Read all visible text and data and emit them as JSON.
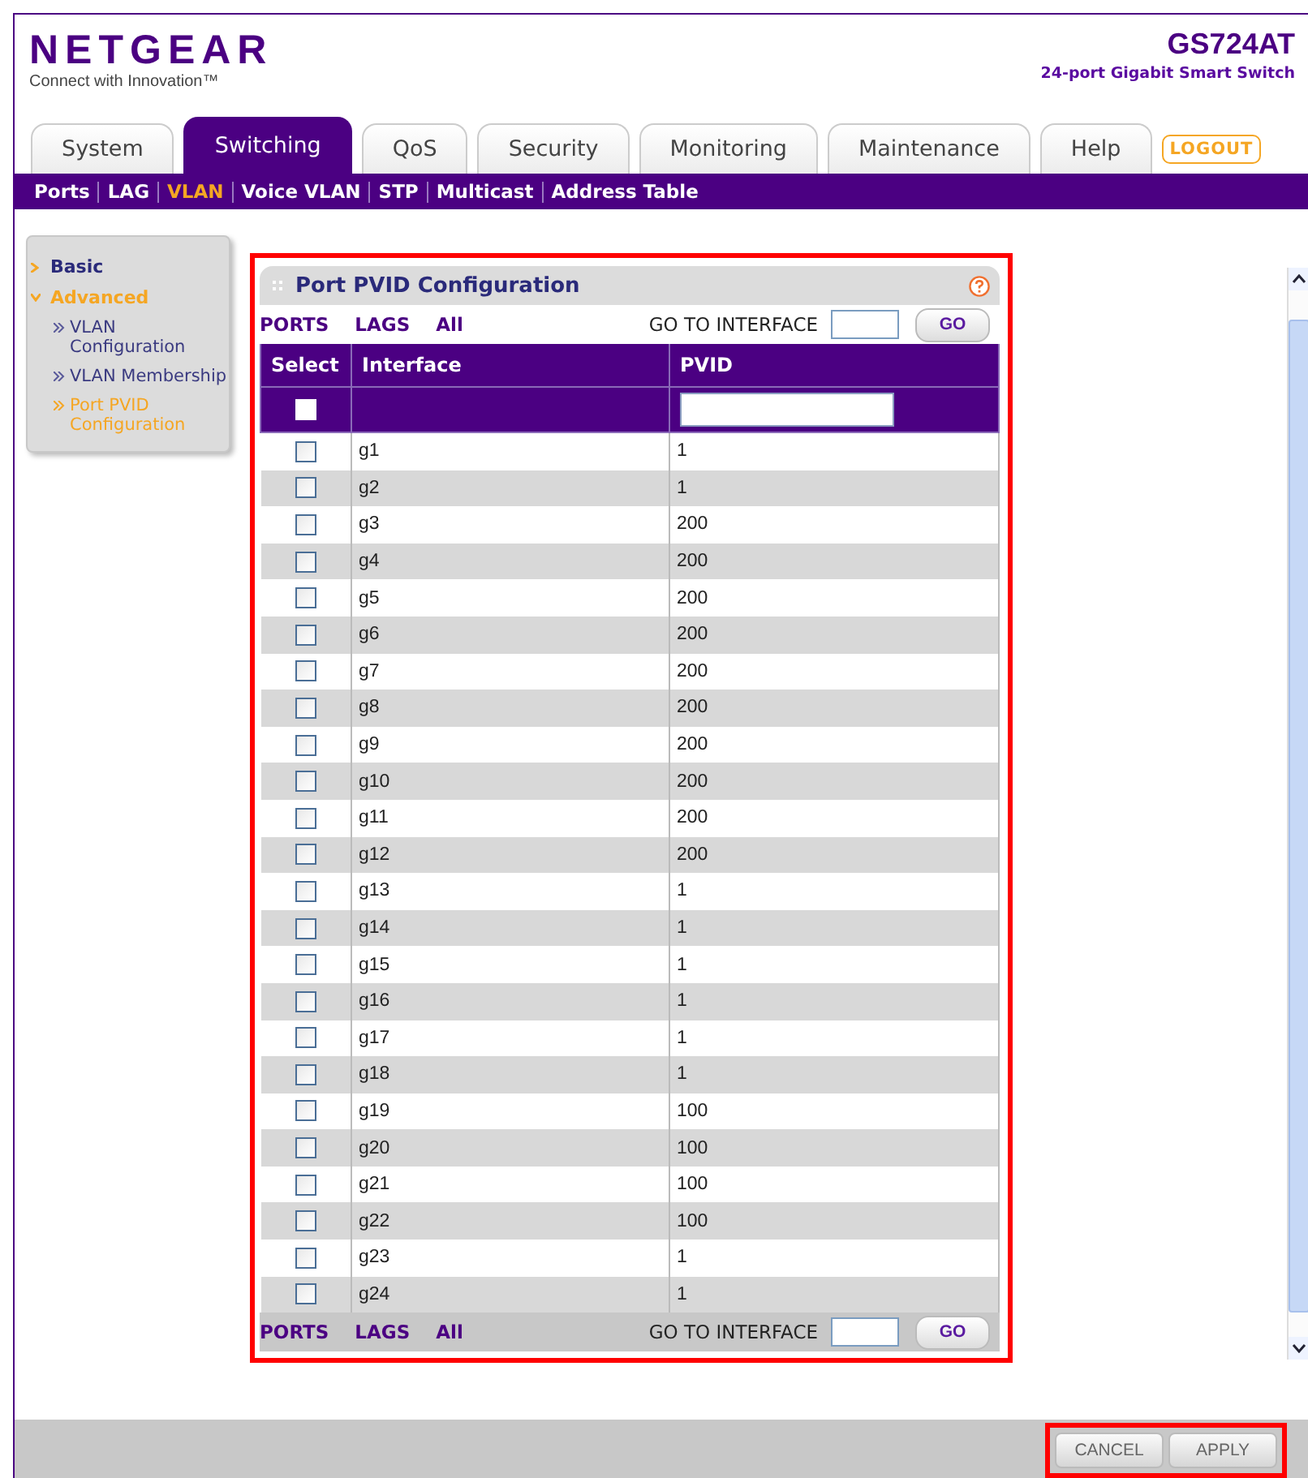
{
  "brand": {
    "logo": "NETGEAR",
    "tagline": "Connect with Innovation™",
    "model": "GS724AT",
    "model_desc": "24-port Gigabit Smart Switch"
  },
  "tabs": [
    {
      "label": "System",
      "selected": false
    },
    {
      "label": "Switching",
      "selected": true
    },
    {
      "label": "QoS",
      "selected": false
    },
    {
      "label": "Security",
      "selected": false
    },
    {
      "label": "Monitoring",
      "selected": false
    },
    {
      "label": "Maintenance",
      "selected": false
    },
    {
      "label": "Help",
      "selected": false
    }
  ],
  "logout": "LOGOUT",
  "subnav": [
    {
      "label": "Ports",
      "selected": false
    },
    {
      "label": "LAG",
      "selected": false
    },
    {
      "label": "VLAN",
      "selected": true
    },
    {
      "label": "Voice VLAN",
      "selected": false
    },
    {
      "label": "STP",
      "selected": false
    },
    {
      "label": "Multicast",
      "selected": false
    },
    {
      "label": "Address Table",
      "selected": false
    }
  ],
  "sidebar": {
    "items": [
      {
        "label": "Basic",
        "expanded": false,
        "selected": false
      },
      {
        "label": "Advanced",
        "expanded": true,
        "selected": true,
        "children": [
          {
            "label": "VLAN Configuration",
            "selected": false
          },
          {
            "label": "VLAN Membership",
            "selected": false
          },
          {
            "label": "Port PVID Configuration",
            "selected": true
          }
        ]
      }
    ]
  },
  "panel": {
    "title": "Port PVID Configuration",
    "highlighted": true,
    "top_nav": {
      "filters": [
        "PORTS",
        "LAGS",
        "All"
      ],
      "goto_label": "GO TO INTERFACE",
      "go": "GO"
    },
    "columns": [
      "Select",
      "Interface",
      "PVID"
    ],
    "header_checked": false,
    "rows": [
      {
        "interface": "g1",
        "pvid": "1",
        "checked": false
      },
      {
        "interface": "g2",
        "pvid": "1",
        "checked": false
      },
      {
        "interface": "g3",
        "pvid": "200",
        "checked": false
      },
      {
        "interface": "g4",
        "pvid": "200",
        "checked": false
      },
      {
        "interface": "g5",
        "pvid": "200",
        "checked": false
      },
      {
        "interface": "g6",
        "pvid": "200",
        "checked": false
      },
      {
        "interface": "g7",
        "pvid": "200",
        "checked": false
      },
      {
        "interface": "g8",
        "pvid": "200",
        "checked": false
      },
      {
        "interface": "g9",
        "pvid": "200",
        "checked": false
      },
      {
        "interface": "g10",
        "pvid": "200",
        "checked": false
      },
      {
        "interface": "g11",
        "pvid": "200",
        "checked": false
      },
      {
        "interface": "g12",
        "pvid": "200",
        "checked": false
      },
      {
        "interface": "g13",
        "pvid": "1",
        "checked": false
      },
      {
        "interface": "g14",
        "pvid": "1",
        "checked": false
      },
      {
        "interface": "g15",
        "pvid": "1",
        "checked": false
      },
      {
        "interface": "g16",
        "pvid": "1",
        "checked": false
      },
      {
        "interface": "g17",
        "pvid": "1",
        "checked": false
      },
      {
        "interface": "g18",
        "pvid": "1",
        "checked": false
      },
      {
        "interface": "g19",
        "pvid": "100",
        "checked": false
      },
      {
        "interface": "g20",
        "pvid": "100",
        "checked": false
      },
      {
        "interface": "g21",
        "pvid": "100",
        "checked": false
      },
      {
        "interface": "g22",
        "pvid": "100",
        "checked": false
      },
      {
        "interface": "g23",
        "pvid": "1",
        "checked": false
      },
      {
        "interface": "g24",
        "pvid": "1",
        "checked": false
      }
    ],
    "bottom_nav": {
      "filters": [
        "PORTS",
        "LAGS",
        "All"
      ],
      "goto_label": "GO TO INTERFACE",
      "go": "GO"
    }
  },
  "actions": {
    "highlighted": true,
    "buttons": [
      "CANCEL",
      "APPLY"
    ]
  }
}
